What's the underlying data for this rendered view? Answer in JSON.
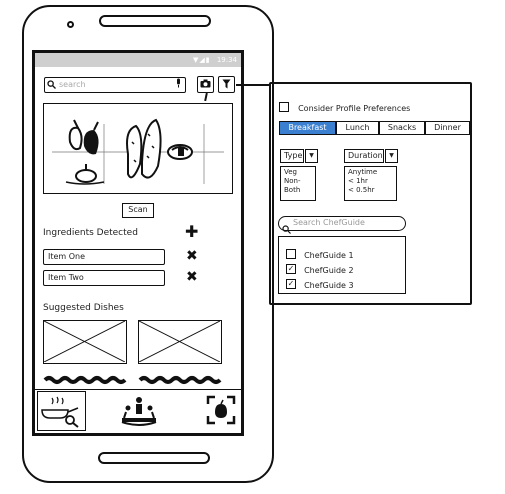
{
  "status_bar": {
    "signal": "▼◢▮",
    "time": "19:34"
  },
  "search": {
    "placeholder": "search"
  },
  "icons": {
    "search": "search-icon",
    "mic": "mic-icon",
    "camera": "camera-icon",
    "filter": "filter-icon",
    "plus": "plus-icon",
    "remove": "close-icon"
  },
  "scan": {
    "label": "Scan"
  },
  "ingredients": {
    "title": "Ingredients Detected",
    "items": [
      {
        "label": "Item One"
      },
      {
        "label": "Item Two"
      }
    ]
  },
  "suggested": {
    "title": "Suggested Dishes"
  },
  "tabs": [
    {
      "name": "cooking-search"
    },
    {
      "name": "chef-table"
    },
    {
      "name": "scan-ingredient"
    }
  ],
  "filter_panel": {
    "profile_pref": {
      "label": "Consider Profile Preferences",
      "checked": false
    },
    "meals": [
      {
        "label": "Breakfast",
        "active": true
      },
      {
        "label": "Lunch",
        "active": false
      },
      {
        "label": "Snacks",
        "active": false
      },
      {
        "label": "Dinner",
        "active": false
      }
    ],
    "type": {
      "label": "Type",
      "options": [
        "Veg",
        "Non-",
        "Both"
      ]
    },
    "duration": {
      "label": "Duration",
      "options": [
        "Anytime",
        "< 1hr",
        "< 0.5hr"
      ]
    },
    "chef_search": {
      "placeholder": "Search ChefGuide"
    },
    "chef_guides": [
      {
        "label": "ChefGuide 1",
        "checked": false
      },
      {
        "label": "ChefGuide 2",
        "checked": true
      },
      {
        "label": "ChefGuide 3",
        "checked": true
      }
    ]
  },
  "colors": {
    "accent": "#3b80d0",
    "statusbar": "#cfcfcf",
    "ink": "#111111"
  }
}
